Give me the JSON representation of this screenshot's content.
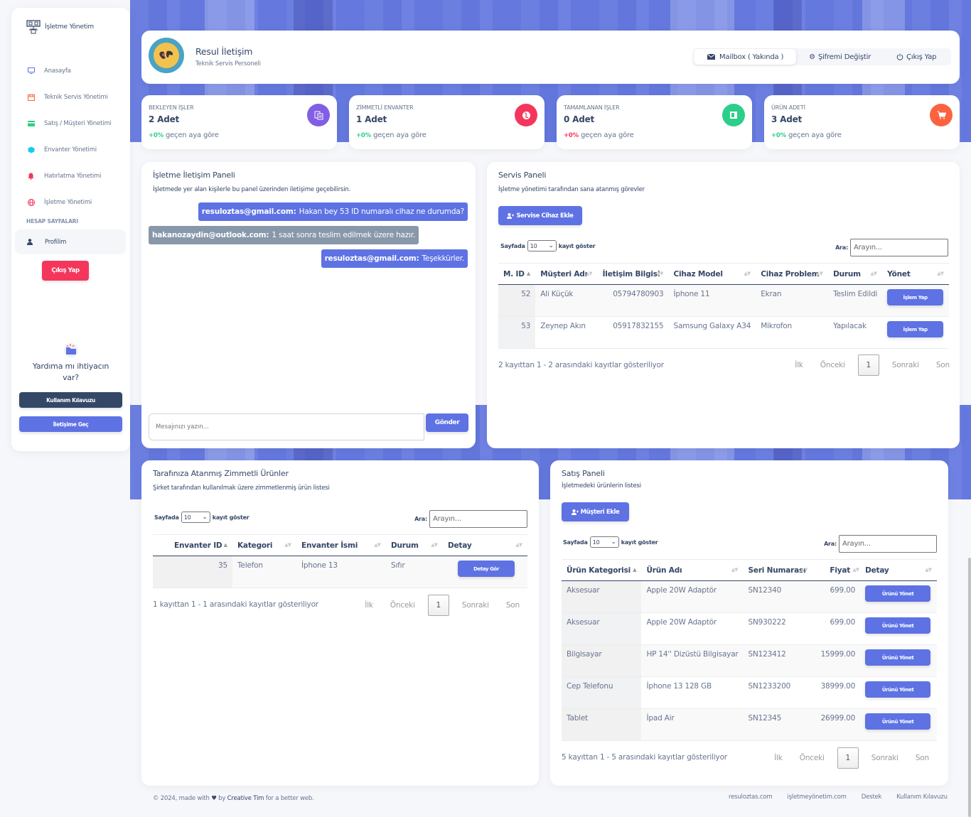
{
  "brand": {
    "name": "İşletme Yönetim"
  },
  "sidebar": {
    "items": [
      {
        "label": "Anasayfa",
        "icon": "monitor-icon",
        "color": "#5e72e4"
      },
      {
        "label": "Teknik Servis Yönetimi",
        "icon": "calendar-icon",
        "color": "#fb6340"
      },
      {
        "label": "Satış / Müşteri Yönetimi",
        "icon": "credit-card-icon",
        "color": "#2dce89"
      },
      {
        "label": "Envanter Yönetimi",
        "icon": "box-icon",
        "color": "#11cdef"
      },
      {
        "label": "Hatırlatma Yönetimi",
        "icon": "bell-icon",
        "color": "#f5365c"
      },
      {
        "label": "İşletme Yönetimi",
        "icon": "globe-icon",
        "color": "#f5365c"
      }
    ],
    "section_title": "HESAP SAYFALARI",
    "active_item": "Profilim",
    "logout_label": "Çıkış Yap",
    "help_text": "Yardıma mı ihtiyacın var?",
    "guide_label": "Kullanım Kılavuzu",
    "contact_label": "İletişime Geç"
  },
  "profile": {
    "name": "Resul İletişim",
    "role": "Teknik Servis Personeli",
    "actions": {
      "mailbox": "Mailbox ( Yakında )",
      "password": "Şifremi Değiştir",
      "logout": "Çıkış Yap"
    }
  },
  "stats": [
    {
      "title": "BEKLEYEN İŞLER",
      "value": "2 Adet",
      "delta": "+0%",
      "delta_text": "geçen aya göre",
      "color": "#825ee4",
      "icon": "document-icon"
    },
    {
      "title": "ZİMMETLİ ENVANTER",
      "value": "1 Adet",
      "delta": "+0%",
      "delta_text": "geçen aya göre",
      "color": "#f5365c",
      "icon": "globe-icon"
    },
    {
      "title": "TAMAMLANAN İŞLER",
      "value": "0 Adet",
      "delta": "+0%",
      "delta_text": "geçen aya göre",
      "color": "#2dce89",
      "icon": "paper-icon"
    },
    {
      "title": "ÜRÜN ADETİ",
      "value": "3 Adet",
      "delta": "+0%",
      "delta_text": "geçen aya göre",
      "color": "#fb6340",
      "icon": "cart-icon"
    }
  ],
  "chat": {
    "title": "İşletme İletişim Paneli",
    "subtitle": "İşletmede yer alan kişilerle bu panel üzerinden iletişime geçebilirsin.",
    "messages": [
      {
        "from": "resuloztas@gmail.com:",
        "text": "Hakan bey 53 ID numaralı cihaz ne durumda?",
        "mine": true
      },
      {
        "from": "hakanozaydin@outlook.com:",
        "text": "1 saat sonra teslim edilmek üzere hazır.",
        "mine": false
      },
      {
        "from": "resuloztas@gmail.com:",
        "text": "Teşekkürler.",
        "mine": true
      }
    ],
    "input_placeholder": "Mesajınızı yazın...",
    "send_label": "Gönder"
  },
  "service": {
    "title": "Servis Paneli",
    "subtitle": "İşletme yönetimi tarafından sana atanmış görevler",
    "add_label": "Servise Cihaz Ekle",
    "len_prefix": "Sayfada",
    "len_value": "10",
    "len_suffix": "kayıt göster",
    "search_label": "Ara:",
    "search_placeholder": "Arayın...",
    "columns": [
      "M. ID",
      "Müşteri Adı",
      "İletişim Bilgisi",
      "Cihaz Model",
      "Cihaz Problem",
      "Durum",
      "Yönet"
    ],
    "rows": [
      [
        "52",
        "Ali Küçük",
        "05794780903",
        "İphone 11",
        "Ekran",
        "Teslim Edildi",
        "İşlem Yap"
      ],
      [
        "53",
        "Zeynep Akın",
        "05917832155",
        "Samsung Galaxy A34",
        "Mikrofon",
        "Yapılacak",
        "İşlem Yap"
      ]
    ],
    "info": "2 kayıttan 1 - 2 arasındaki kayıtlar gösteriliyor"
  },
  "inventory": {
    "title": "Tarafınıza Atanmış Zimmetli Ürünler",
    "subtitle": "Şirket tarafından kullanılmak üzere zimmetlenmiş ürün listesi",
    "len_prefix": "Sayfada",
    "len_value": "10",
    "len_suffix": "kayıt göster",
    "search_label": "Ara:",
    "search_placeholder": "Arayın...",
    "columns": [
      "Envanter ID",
      "Kategori",
      "Envanter İsmi",
      "Durum",
      "Detay"
    ],
    "rows": [
      [
        "35",
        "Telefon",
        "İphone 13",
        "Sıfır",
        "Detay Gör"
      ]
    ],
    "info": "1 kayıttan 1 - 1 arasındaki kayıtlar gösteriliyor"
  },
  "sales": {
    "title": "Satış Paneli",
    "subtitle": "İşletmedeki ürünlerin listesi",
    "add_label": "Müşteri Ekle",
    "len_prefix": "Sayfada",
    "len_value": "10",
    "len_suffix": "kayıt göster",
    "search_label": "Ara:",
    "search_placeholder": "Arayın...",
    "columns": [
      "Ürün Kategorisi",
      "Ürün Adı",
      "Seri Numarası",
      "Fiyat",
      "Detay"
    ],
    "rows": [
      [
        "Aksesuar",
        "Apple 20W Adaptör",
        "SN12340",
        "699.00",
        "Ürünü Yönet"
      ],
      [
        "Aksesuar",
        "Apple 20W Adaptör",
        "SN930222",
        "699.00",
        "Ürünü Yönet"
      ],
      [
        "Bilgisayar",
        "HP 14'' Dizüstü Bilgisayar",
        "SN123412",
        "15999.00",
        "Ürünü Yönet"
      ],
      [
        "Cep Telefonu",
        "İphone 13 128 GB",
        "SN1233200",
        "38999.00",
        "Ürünü Yönet"
      ],
      [
        "Tablet",
        "İpad Air",
        "SN12345",
        "26999.00",
        "Ürünü Yönet"
      ]
    ],
    "info": "5 kayıttan 1 - 5 arasındaki kayıtlar gösteriliyor"
  },
  "pager": {
    "first": "İlk",
    "prev": "Önceki",
    "current": "1",
    "next": "Sonraki",
    "last": "Son"
  },
  "footer": {
    "prefix": "© 2024, made with",
    "by": "by",
    "author": "Creative Tim",
    "suffix": "for a better web.",
    "links": [
      "resuloztas.com",
      "işletmeyönetim.com",
      "Destek",
      "Kullanım Kılavuzu"
    ]
  }
}
